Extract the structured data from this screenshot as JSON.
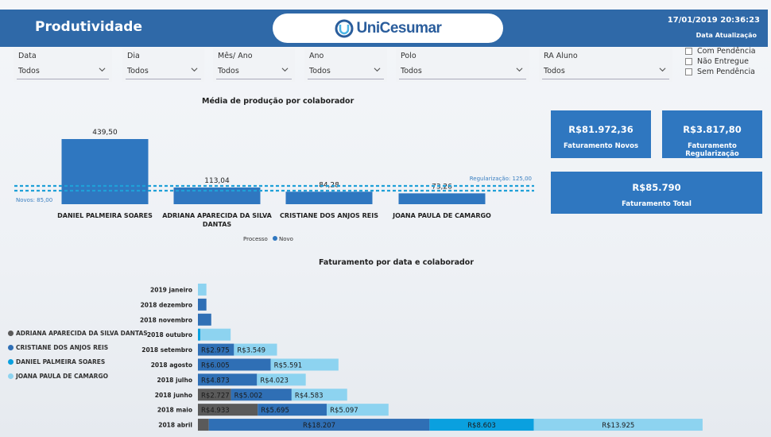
{
  "header": {
    "title": "Produtividade",
    "logo_text": "UniCesumar",
    "datetime": "17/01/2019 20:36:23",
    "date_label": "Data Atualização"
  },
  "filters": [
    {
      "label": "Data",
      "value": "Todos"
    },
    {
      "label": "Dia",
      "value": "Todos"
    },
    {
      "label": "Mês/ Ano",
      "value": "Todos"
    },
    {
      "label": "Ano",
      "value": "Todos"
    },
    {
      "label": "Polo",
      "value": "Todos"
    },
    {
      "label": "RA Aluno",
      "value": "Todos"
    }
  ],
  "checkboxes": [
    "Com Pendência",
    "Não Entregue",
    "Sem Pendência"
  ],
  "kpis": [
    {
      "value": "R$81.972,36",
      "label": "Faturamento Novos"
    },
    {
      "value": "R$3.817,80",
      "label": "Faturamento Regularização"
    },
    {
      "value": "R$85.790",
      "label": "Faturamento Total"
    }
  ],
  "colors": {
    "header": "#2f69a8",
    "kpi": "#2f77c0",
    "bar": "#2f77c0",
    "ref_line": "#1fa0d8",
    "adriana": "#5a5a5a",
    "cristiane": "#2f6fb5",
    "daniel": "#0aa0df",
    "joana": "#8dd3f0"
  },
  "chart_data": [
    {
      "type": "bar",
      "title": "Média de produção por colaborador",
      "categories": [
        "DANIEL PALMEIRA SOARES",
        "ADRIANA APARECIDA DA SILVA DANTAS",
        "CRISTIANE DOS ANJOS REIS",
        "JOANA PAULA DE CAMARGO"
      ],
      "values": [
        439.5,
        113.04,
        84.28,
        73.26
      ],
      "value_labels": [
        "439,50",
        "113,04",
        "84,28",
        "73,26"
      ],
      "ref_lines": [
        {
          "label": "Regularização: 125,00",
          "value": 125
        },
        {
          "label": "Novos: 85,00",
          "value": 85
        }
      ],
      "legend_title": "Processo",
      "legend": [
        "Novo"
      ]
    },
    {
      "type": "bar",
      "title": "Faturamento por data e colaborador",
      "orientation": "horizontal-stacked",
      "categories": [
        "2019 janeiro",
        "2018 dezembro",
        "2018 novembro",
        "2018 outubro",
        "2018 setembro",
        "2018 agosto",
        "2018 julho",
        "2018 junho",
        "2018 maio",
        "2018 abril"
      ],
      "series": [
        {
          "name": "ADRIANA APARECIDA DA SILVA DANTAS",
          "values": [
            0,
            0,
            0,
            0,
            0,
            0,
            0,
            2727,
            4933,
            900
          ]
        },
        {
          "name": "CRISTIANE DOS ANJOS REIS",
          "values": [
            0,
            700,
            1100,
            0,
            2975,
            6005,
            4873,
            5002,
            5695,
            18207
          ]
        },
        {
          "name": "DANIEL PALMEIRA SOARES",
          "values": [
            0,
            0,
            0,
            200,
            0,
            0,
            0,
            0,
            0,
            8603
          ]
        },
        {
          "name": "JOANA PAULA DE CAMARGO",
          "values": [
            700,
            0,
            0,
            2500,
            3549,
            5591,
            4023,
            4583,
            5097,
            13925
          ]
        }
      ],
      "value_labels": {
        "2018 setembro": [
          "",
          "R$2.975",
          "",
          "R$3.549"
        ],
        "2018 agosto": [
          "",
          "R$6.005",
          "",
          "R$5.591"
        ],
        "2018 julho": [
          "",
          "R$4.873",
          "",
          "R$4.023"
        ],
        "2018 junho": [
          "R$2.727",
          "R$5.002",
          "",
          "R$4.583"
        ],
        "2018 maio": [
          "R$4.933",
          "R$5.695",
          "",
          "R$5.097"
        ],
        "2018 abril": [
          "",
          "R$18.207",
          "R$8.603",
          "R$13.925"
        ]
      }
    }
  ]
}
